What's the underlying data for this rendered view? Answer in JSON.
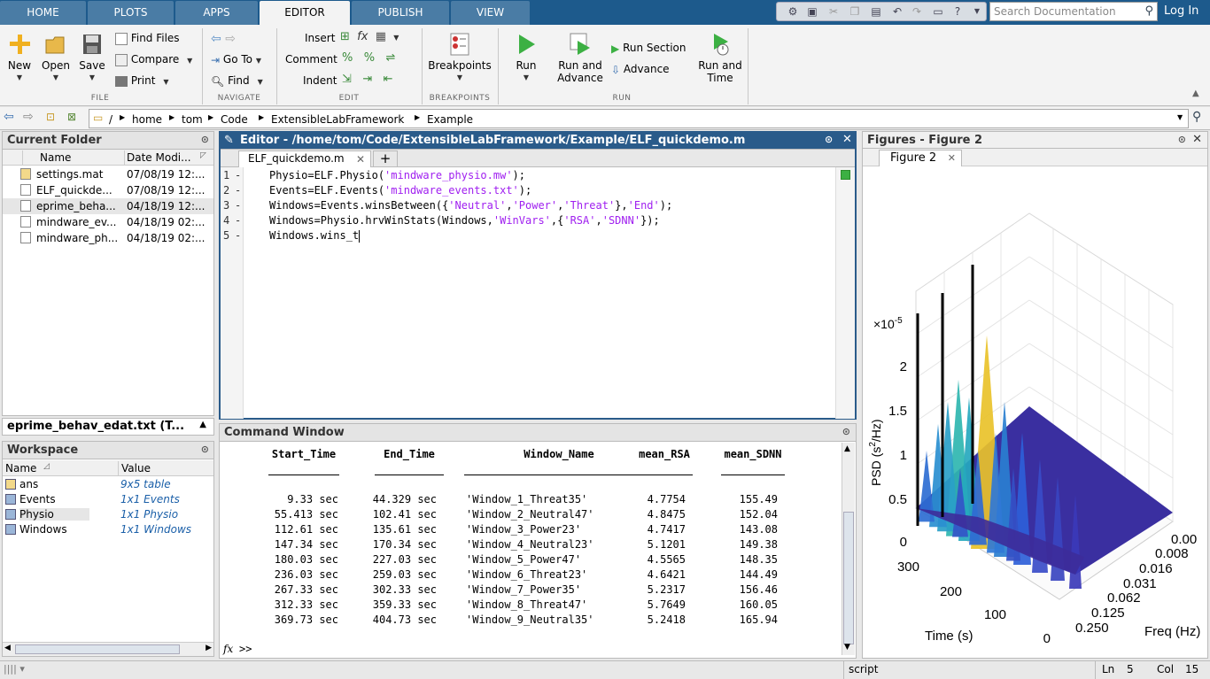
{
  "top_tabs": [
    "HOME",
    "PLOTS",
    "APPS",
    "EDITOR",
    "PUBLISH",
    "VIEW"
  ],
  "active_tab": "EDITOR",
  "search_placeholder": "Search Documentation",
  "login_label": "Log In",
  "ribbon": {
    "file": {
      "label": "FILE",
      "new": "New",
      "open": "Open",
      "save": "Save",
      "find_files": "Find Files",
      "compare": "Compare",
      "print": "Print"
    },
    "navigate": {
      "label": "NAVIGATE",
      "go_to": "Go To",
      "find": "Find"
    },
    "edit": {
      "label": "EDIT",
      "insert": "Insert",
      "comment": "Comment",
      "indent": "Indent"
    },
    "breakpoints": {
      "label": "BREAKPOINTS",
      "breakpoints": "Breakpoints"
    },
    "run": {
      "label": "RUN",
      "run": "Run",
      "run_and_advance_1": "Run and",
      "run_and_advance_2": "Advance",
      "run_section": "Run Section",
      "advance": "Advance",
      "run_and_time_1": "Run and",
      "run_and_time_2": "Time"
    }
  },
  "path": [
    "/",
    "home",
    "tom",
    "Code",
    "ExtensibleLabFramework",
    "Example"
  ],
  "current_folder": {
    "title": "Current Folder",
    "col_name": "Name",
    "col_date": "Date Modi...",
    "files": [
      {
        "name": "settings.mat",
        "date": "07/08/19 12:...",
        "icon": "mat-file-icon"
      },
      {
        "name": "ELF_quickde...",
        "date": "07/08/19 12:...",
        "icon": "m-file-icon"
      },
      {
        "name": "eprime_beha...",
        "date": "04/18/19 12:...",
        "icon": "text-file-icon"
      },
      {
        "name": "mindware_ev...",
        "date": "04/18/19 02:...",
        "icon": "text-file-icon"
      },
      {
        "name": "mindware_ph...",
        "date": "04/18/19 02:...",
        "icon": "text-file-icon"
      }
    ],
    "details": "eprime_behav_edat.txt  (T..."
  },
  "workspace": {
    "title": "Workspace",
    "col_name": "Name",
    "col_value": "Value",
    "vars": [
      {
        "name": "ans",
        "value": "9x5 table"
      },
      {
        "name": "Events",
        "value": "1x1 Events"
      },
      {
        "name": "Physio",
        "value": "1x1 Physio"
      },
      {
        "name": "Windows",
        "value": "1x1 Windows"
      }
    ]
  },
  "editor": {
    "title": "Editor - /home/tom/Code/ExtensibleLabFramework/Example/ELF_quickdemo.m",
    "tab": "ELF_quickdemo.m",
    "line_numbers": [
      "1",
      "2",
      "3",
      "4",
      "5"
    ],
    "lines": [
      [
        {
          "t": "Physio=ELF.Physio(",
          "s": false
        },
        {
          "t": "'mindware_physio.mw'",
          "s": true
        },
        {
          "t": ");",
          "s": false
        }
      ],
      [
        {
          "t": "Events=ELF.Events(",
          "s": false
        },
        {
          "t": "'mindware_events.txt'",
          "s": true
        },
        {
          "t": ");",
          "s": false
        }
      ],
      [
        {
          "t": "Windows=Events.winsBetween({",
          "s": false
        },
        {
          "t": "'Neutral'",
          "s": true
        },
        {
          "t": ",",
          "s": false
        },
        {
          "t": "'Power'",
          "s": true
        },
        {
          "t": ",",
          "s": false
        },
        {
          "t": "'Threat'",
          "s": true
        },
        {
          "t": "},",
          "s": false
        },
        {
          "t": "'End'",
          "s": true
        },
        {
          "t": ");",
          "s": false
        }
      ],
      [
        {
          "t": "Windows=Physio.hrvWinStats(Windows,",
          "s": false
        },
        {
          "t": "'WinVars'",
          "s": true
        },
        {
          "t": ",{",
          "s": false
        },
        {
          "t": "'RSA'",
          "s": true
        },
        {
          "t": ",",
          "s": false
        },
        {
          "t": "'SDNN'",
          "s": true
        },
        {
          "t": "});",
          "s": false
        }
      ],
      [
        {
          "t": "Windows.wins_t",
          "s": false
        }
      ]
    ]
  },
  "command_window": {
    "title": "Command Window",
    "headers": [
      "Start_Time",
      "End_Time",
      "Window_Name",
      "mean_RSA",
      "mean_SDNN"
    ],
    "rows": [
      [
        "9.33 sec",
        "44.329 sec",
        "'Window_1_Threat35'",
        "4.7754",
        "155.49"
      ],
      [
        "55.413 sec",
        "102.41 sec",
        "'Window_2_Neutral47'",
        "4.8475",
        "152.04"
      ],
      [
        "112.61 sec",
        "135.61 sec",
        "'Window_3_Power23'",
        "4.7417",
        "143.08"
      ],
      [
        "147.34 sec",
        "170.34 sec",
        "'Window_4_Neutral23'",
        "5.1201",
        "149.38"
      ],
      [
        "180.03 sec",
        "227.03 sec",
        "'Window_5_Power47'",
        "4.5565",
        "148.35"
      ],
      [
        "236.03 sec",
        "259.03 sec",
        "'Window_6_Threat23'",
        "4.6421",
        "144.49"
      ],
      [
        "267.33 sec",
        "302.33 sec",
        "'Window_7_Power35'",
        "5.2317",
        "156.46"
      ],
      [
        "312.33 sec",
        "359.33 sec",
        "'Window_8_Threat47'",
        "5.7649",
        "160.05"
      ],
      [
        "369.73 sec",
        "404.73 sec",
        "'Window_9_Neutral35'",
        "5.2418",
        "165.94"
      ]
    ],
    "prompt": ">>",
    "fx": "fx"
  },
  "figures": {
    "title": "Figures - Figure 2",
    "tab": "Figure 2",
    "exponent": "×10",
    "exponent_power": "-5",
    "zlabel_1": "PSD (s",
    "zlabel_sup": "2",
    "zlabel_2": "/Hz)",
    "xlabel": "Time (s)",
    "ylabel": "Freq (Hz)",
    "z_ticks": [
      "2",
      "1.5",
      "1",
      "0.5",
      "0"
    ],
    "time_ticks": [
      "300",
      "200",
      "100",
      "0"
    ],
    "freq_ticks": [
      "0.00",
      "0.008",
      "0.016",
      "0.031",
      "0.062",
      "0.125",
      "0.250"
    ]
  },
  "status": {
    "mode": "script",
    "ln_label": "Ln",
    "ln": "5",
    "col_label": "Col",
    "col": "15"
  },
  "colors": {
    "title_blue": "#2a5b8a",
    "tab_bar": "#1d5a8c",
    "string": "#a020f0",
    "workspace_value": "#1a5fa8"
  }
}
